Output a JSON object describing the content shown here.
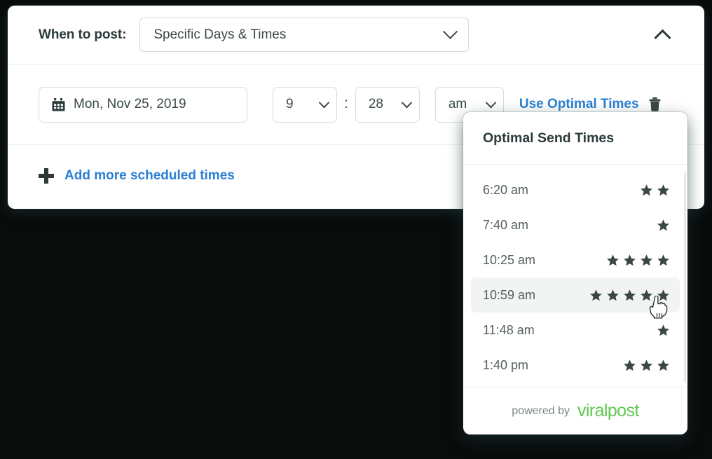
{
  "schedule": {
    "when_label": "When to post:",
    "when_value": "Specific Days & Times",
    "collapse_icon": "chevron-up-icon",
    "date_value": "Mon, Nov 25, 2019",
    "calendar_icon": "calendar-icon",
    "hour_value": "9",
    "separator": ":",
    "minute_value": "28",
    "ampm_value": "am",
    "optimal_times_link": "Use Optimal Times",
    "trash_icon": "trash-icon",
    "plus_icon": "plus-icon",
    "add_more_link": "Add more scheduled times",
    "accent_blue": "#2a7fd4",
    "text_dark": "#2b3a3a",
    "border_gray": "#d7dcdc"
  },
  "optimal_panel": {
    "title": "Optimal Send Times",
    "rows": [
      {
        "time": "6:20 am",
        "stars": 2,
        "active": false
      },
      {
        "time": "7:40 am",
        "stars": 1,
        "active": false
      },
      {
        "time": "10:25 am",
        "stars": 4,
        "active": false
      },
      {
        "time": "10:59 am",
        "stars": 5,
        "active": true
      },
      {
        "time": "11:48 am",
        "stars": 1,
        "active": false
      },
      {
        "time": "1:40 pm",
        "stars": 3,
        "active": false
      }
    ],
    "footer": {
      "powered_by": "powered by",
      "brand": "viralpost",
      "brand_color": "#5ec84f"
    },
    "star_color": "#3a4746",
    "active_row_bg": "#f2f4f4"
  }
}
